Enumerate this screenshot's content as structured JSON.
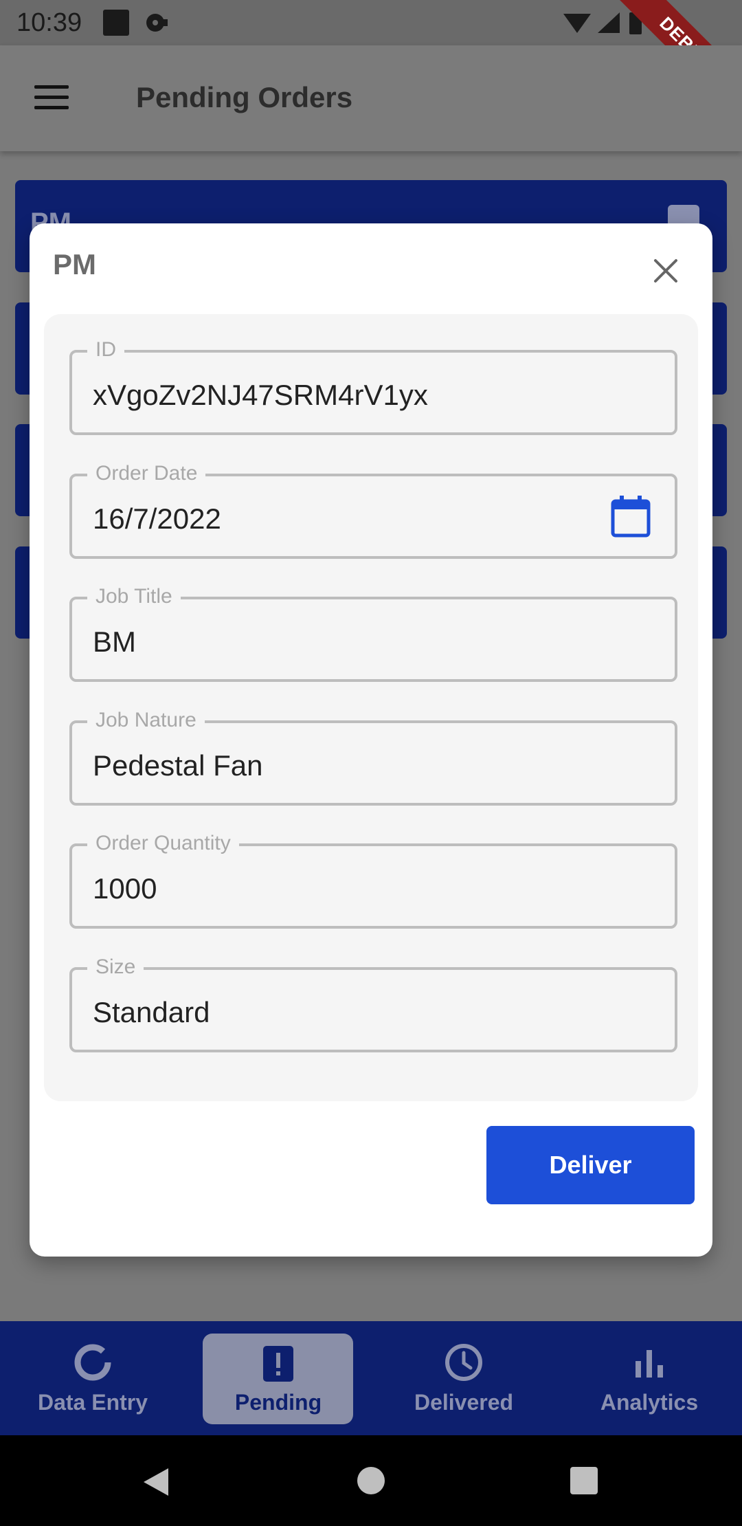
{
  "status_bar": {
    "time": "10:39",
    "debug_label": "DEBUG"
  },
  "app_bar": {
    "title": "Pending Orders"
  },
  "background_cards": [
    {
      "title": "PM"
    },
    {
      "title": ""
    },
    {
      "title": ""
    },
    {
      "title": ""
    }
  ],
  "dialog": {
    "title": "PM",
    "fields": [
      {
        "label": "ID",
        "value": "xVgoZv2NJ47SRM4rV1yx"
      },
      {
        "label": "Order Date",
        "value": "16/7/2022"
      },
      {
        "label": "Job Title",
        "value": "BM"
      },
      {
        "label": "Job Nature",
        "value": "Pedestal Fan"
      },
      {
        "label": "Order Quantity",
        "value": "1000"
      },
      {
        "label": "Size",
        "value": "Standard"
      }
    ],
    "deliver_label": "Deliver"
  },
  "bottom_nav": {
    "items": [
      {
        "label": "Data Entry",
        "icon": "circle-progress-icon"
      },
      {
        "label": "Pending",
        "icon": "clipboard-alert-icon",
        "active": true
      },
      {
        "label": "Delivered",
        "icon": "clock-icon"
      },
      {
        "label": "Analytics",
        "icon": "bar-chart-icon"
      }
    ]
  },
  "colors": {
    "primary": "#1d4fd8",
    "nav_background": "#0d1f6e",
    "card_background": "#0d1f6e"
  }
}
